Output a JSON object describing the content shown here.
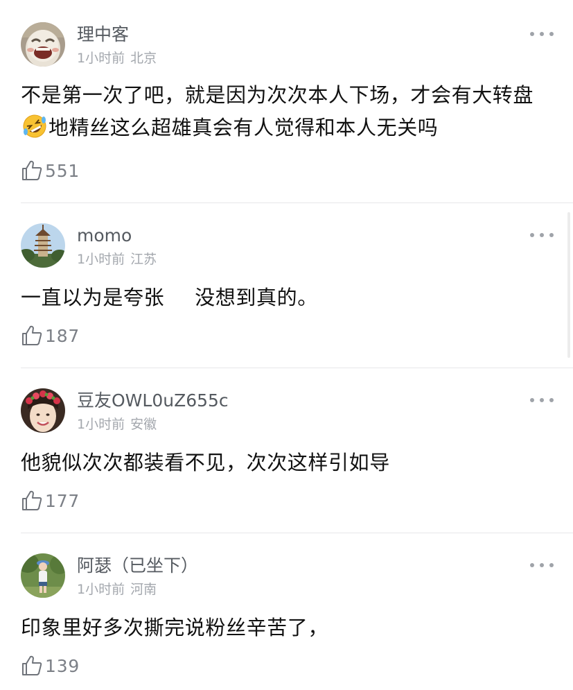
{
  "comments": [
    {
      "username": "理中客",
      "time": "1小时前",
      "location": "北京",
      "text_before_emoji": "不是第一次了吧，就是因为次次本人下场，才会有大转盘",
      "emoji": "rolling-on-the-floor-laughing-emoji",
      "text_after_emoji": "地精丝这么超雄真会有人觉得和本人无关吗",
      "likes": "551",
      "avatar": "laughing-mask-avatar"
    },
    {
      "username": "momo",
      "time": "1小时前",
      "location": "江苏",
      "text_part1": "一直以为是夸张",
      "text_part2": "没想到真的。",
      "likes": "187",
      "avatar": "pagoda-photo-avatar"
    },
    {
      "username": "豆友OWL0uZ655c",
      "time": "1小时前",
      "location": "安徽",
      "text": "他貌似次次都装看不见，次次这样引如导",
      "likes": "177",
      "avatar": "flower-crown-girl-avatar"
    },
    {
      "username": "阿瑟（已坐下）",
      "time": "1小时前",
      "location": "河南",
      "text": "印象里好多次撕完说粉丝辛苦了，",
      "likes": "139",
      "avatar": "person-outdoor-photo-avatar"
    }
  ],
  "icons": {
    "more": "more-dots-icon",
    "like": "thumbs-up-icon"
  },
  "colors": {
    "username": "#555a60",
    "meta": "#a3a7ad",
    "text": "#111111",
    "like_count": "#7c8087",
    "divider": "#e6e7e9"
  }
}
